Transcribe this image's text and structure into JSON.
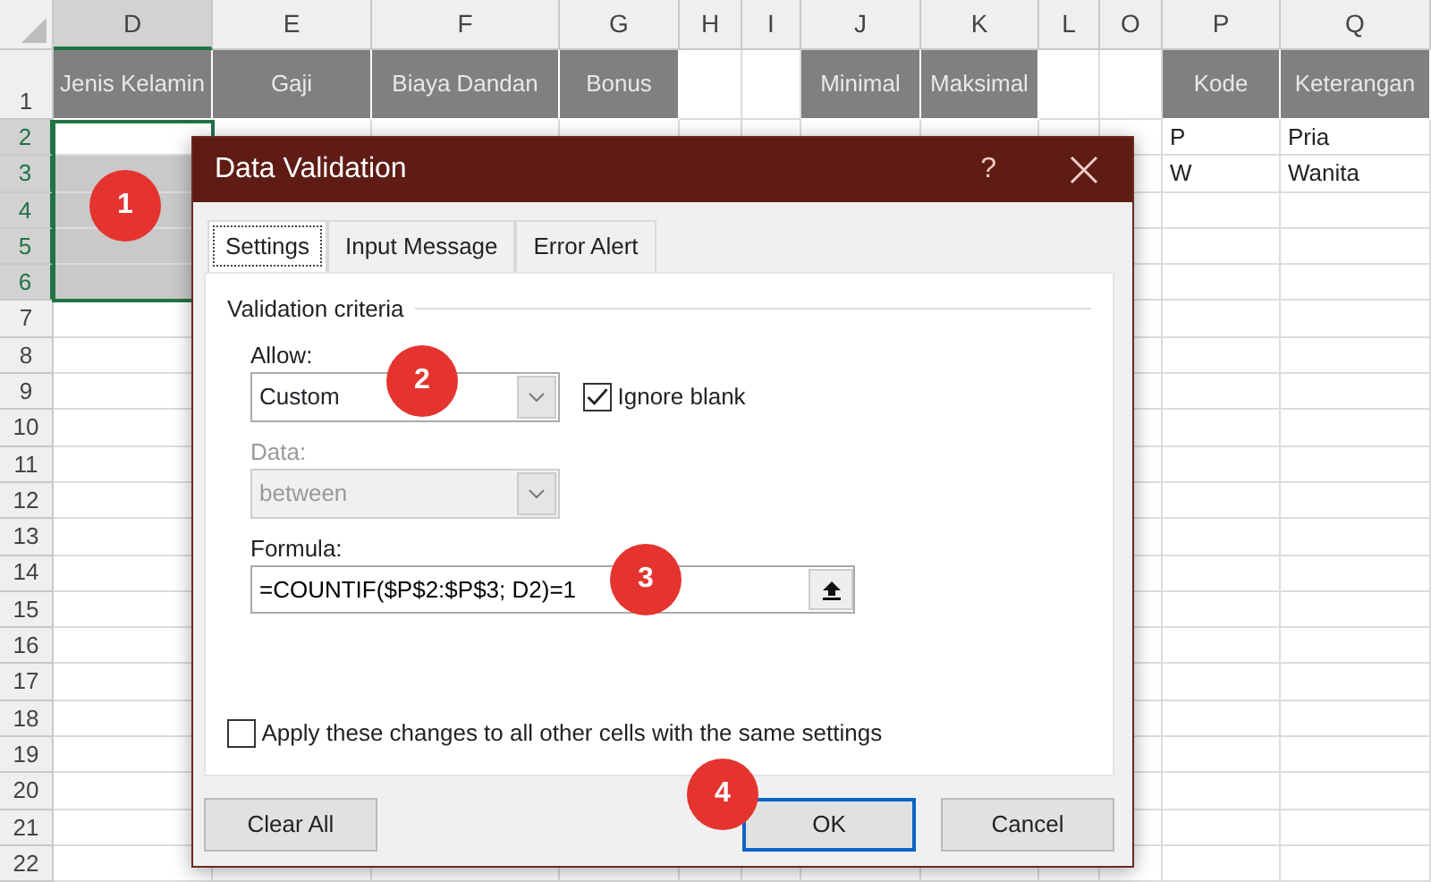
{
  "spreadsheet": {
    "columns": [
      {
        "letter": "D",
        "selected": true
      },
      {
        "letter": "E",
        "selected": false
      },
      {
        "letter": "F",
        "selected": false
      },
      {
        "letter": "G",
        "selected": false
      },
      {
        "letter": "H",
        "selected": false
      },
      {
        "letter": "I",
        "selected": false
      },
      {
        "letter": "J",
        "selected": false
      },
      {
        "letter": "K",
        "selected": false
      },
      {
        "letter": "L",
        "selected": false
      },
      {
        "letter": "O",
        "selected": false
      },
      {
        "letter": "P",
        "selected": false
      },
      {
        "letter": "Q",
        "selected": false
      }
    ],
    "rows": [
      {
        "number": "1",
        "selected": false,
        "cells": {
          "D": "Jenis Kelamin",
          "E": "Gaji",
          "F": "Biaya Dandan",
          "G": "Bonus",
          "J": "Minimal",
          "K": "Maksimal",
          "P": "Kode",
          "Q": "Keterangan"
        }
      },
      {
        "number": "2",
        "selected": true,
        "cells": {
          "P": "P",
          "Q": "Pria"
        }
      },
      {
        "number": "3",
        "selected": true,
        "cells": {
          "P": "W",
          "Q": "Wanita"
        }
      },
      {
        "number": "4",
        "selected": true,
        "cells": {}
      },
      {
        "number": "5",
        "selected": true,
        "cells": {}
      },
      {
        "number": "6",
        "selected": true,
        "cells": {}
      },
      {
        "number": "7",
        "selected": false,
        "cells": {}
      },
      {
        "number": "8",
        "selected": false,
        "cells": {}
      },
      {
        "number": "9",
        "selected": false,
        "cells": {}
      },
      {
        "number": "10",
        "selected": false,
        "cells": {}
      },
      {
        "number": "11",
        "selected": false,
        "cells": {}
      },
      {
        "number": "12",
        "selected": false,
        "cells": {}
      },
      {
        "number": "13",
        "selected": false,
        "cells": {}
      },
      {
        "number": "14",
        "selected": false,
        "cells": {}
      },
      {
        "number": "15",
        "selected": false,
        "cells": {}
      },
      {
        "number": "16",
        "selected": false,
        "cells": {}
      },
      {
        "number": "17",
        "selected": false,
        "cells": {}
      },
      {
        "number": "18",
        "selected": false,
        "cells": {}
      },
      {
        "number": "19",
        "selected": false,
        "cells": {}
      },
      {
        "number": "20",
        "selected": false,
        "cells": {}
      },
      {
        "number": "21",
        "selected": false,
        "cells": {}
      },
      {
        "number": "22",
        "selected": false,
        "cells": {}
      }
    ]
  },
  "dialog": {
    "title": "Data Validation",
    "help": "?",
    "tabs": [
      {
        "label": "Settings",
        "selected": true
      },
      {
        "label": "Input Message",
        "selected": false
      },
      {
        "label": "Error Alert",
        "selected": false
      }
    ],
    "group_label": "Validation criteria",
    "allow": {
      "label": "Allow:",
      "value": "Custom"
    },
    "ignore_blank": {
      "label": "Ignore blank",
      "checked": true
    },
    "data": {
      "label": "Data:",
      "value": "between",
      "disabled": true
    },
    "formula": {
      "label": "Formula:",
      "value": "=COUNTIF($P$2:$P$3; D2)=1"
    },
    "apply_all": {
      "label": "Apply these changes to all other cells with the same settings",
      "checked": false
    },
    "buttons": [
      {
        "label": "Clear All",
        "default": false
      },
      {
        "label": "OK",
        "default": true
      },
      {
        "label": "Cancel",
        "default": false
      }
    ]
  },
  "step_markers": [
    "1",
    "2",
    "3",
    "4"
  ]
}
